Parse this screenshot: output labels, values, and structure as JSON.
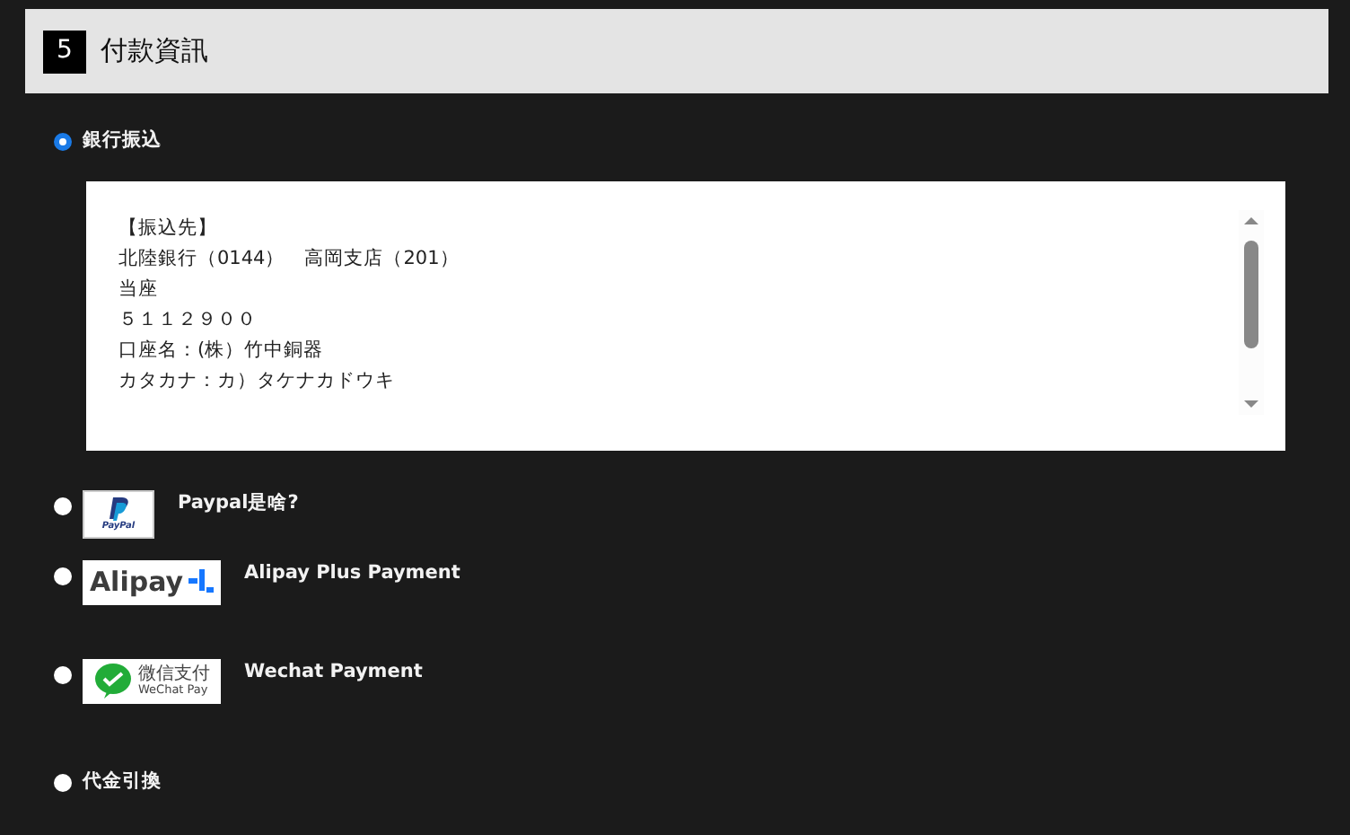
{
  "section": {
    "number": "5",
    "title": "付款資訊"
  },
  "methods": [
    {
      "kind": "bank",
      "label": "銀行振込",
      "selected": true,
      "details": [
        "【振込先】",
        "北陸銀行（0144）　高岡支店（201）",
        "当座",
        "５１１２９００",
        "口座名：(株）竹中銅器",
        "カタカナ：カ）タケナカドウキ"
      ]
    },
    {
      "kind": "paypal",
      "label": "Paypal是啥?",
      "selected": false,
      "logo_text": [
        "PayPal"
      ]
    },
    {
      "kind": "alipay",
      "label": "Alipay Plus Payment",
      "selected": false,
      "logo_text": [
        "Alipay"
      ]
    },
    {
      "kind": "wechat",
      "label": "Wechat Payment",
      "selected": false,
      "logo_text": [
        "微信支付",
        "WeChat Pay"
      ]
    },
    {
      "kind": "plain",
      "label": "代金引換",
      "selected": false
    }
  ]
}
